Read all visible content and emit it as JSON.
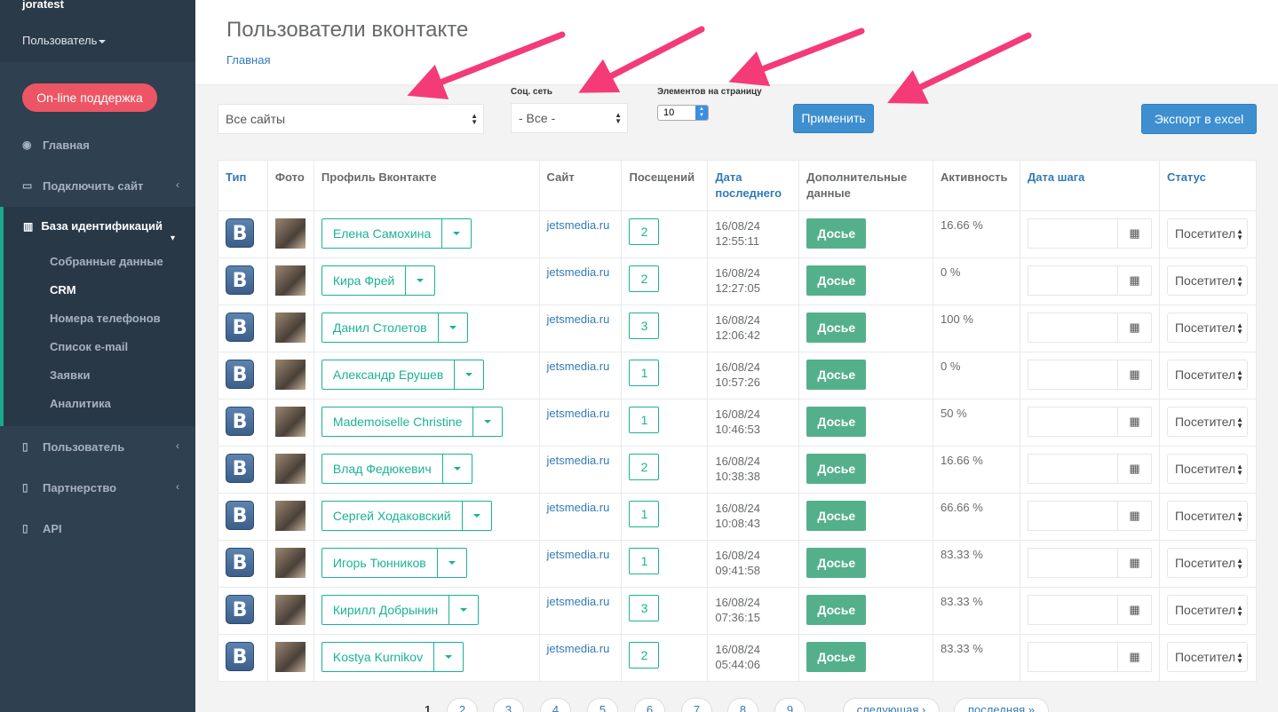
{
  "sidebar": {
    "username": "joratest",
    "role": "Пользователь",
    "support": "On-line поддержка",
    "items": [
      {
        "label": "Главная"
      },
      {
        "label": "Подключить сайт"
      },
      {
        "label": "База идентификаций"
      },
      {
        "label": "Пользователь"
      },
      {
        "label": "Партнерство"
      },
      {
        "label": "API"
      }
    ],
    "subitems": [
      "Собранные данные",
      "CRM",
      "Номера телефонов",
      "Список e-mail",
      "Заявки",
      "Аналитика"
    ]
  },
  "header": {
    "title": "Пользователи вконтакте",
    "breadcrumb": "Главная"
  },
  "filters": {
    "sites_value": "Все сайты",
    "social_label": "Соц. сеть",
    "social_value": "- Все -",
    "per_page_label": "Элементов на страницу",
    "per_page_value": "10",
    "apply": "Применить",
    "export": "Экспорт в excel"
  },
  "table": {
    "headers": [
      "Тип",
      "Фото",
      "Профиль Вконтакте",
      "Сайт",
      "Посещений",
      "Дата последнего",
      "Дополнительные данные",
      "Активность",
      "Дата шага",
      "Статус"
    ],
    "rows": [
      {
        "name": "Елена Самохина",
        "site": "jetsmedia.ru",
        "visits": "2",
        "date": "16/08/24",
        "time": "12:55:11",
        "activity": "16.66 %"
      },
      {
        "name": "Кира Фрей",
        "site": "jetsmedia.ru",
        "visits": "2",
        "date": "16/08/24",
        "time": "12:27:05",
        "activity": "0 %"
      },
      {
        "name": "Данил Столетов",
        "site": "jetsmedia.ru",
        "visits": "3",
        "date": "16/08/24",
        "time": "12:06:42",
        "activity": "100 %"
      },
      {
        "name": "Александр Ерушев",
        "site": "jetsmedia.ru",
        "visits": "1",
        "date": "16/08/24",
        "time": "10:57:26",
        "activity": "0 %"
      },
      {
        "name": "Mademoiselle Christine",
        "site": "jetsmedia.ru",
        "visits": "1",
        "date": "16/08/24",
        "time": "10:46:53",
        "activity": "50 %"
      },
      {
        "name": "Влад Федюкевич",
        "site": "jetsmedia.ru",
        "visits": "2",
        "date": "16/08/24",
        "time": "10:38:38",
        "activity": "16.66 %"
      },
      {
        "name": "Сергей Ходаковский",
        "site": "jetsmedia.ru",
        "visits": "1",
        "date": "16/08/24",
        "time": "10:08:43",
        "activity": "66.66 %"
      },
      {
        "name": "Игорь Тюнников",
        "site": "jetsmedia.ru",
        "visits": "1",
        "date": "16/08/24",
        "time": "09:41:58",
        "activity": "83.33 %"
      },
      {
        "name": "Кирилл Добрынин",
        "site": "jetsmedia.ru",
        "visits": "3",
        "date": "16/08/24",
        "time": "07:36:15",
        "activity": "83.33 %"
      },
      {
        "name": "Kostya Kurnikov",
        "site": "jetsmedia.ru",
        "visits": "2",
        "date": "16/08/24",
        "time": "05:44:06",
        "activity": "83.33 %"
      }
    ],
    "dossier_label": "Досье",
    "status_value": "Посетитель",
    "type_glyph": "B"
  },
  "pagination": {
    "current": "1",
    "pages": [
      "2",
      "3",
      "4",
      "5",
      "6",
      "7",
      "8",
      "9"
    ],
    "next": "следующая ›",
    "last": "последняя »"
  },
  "colors": {
    "sidebar": "#2f4050",
    "accent": "#1ab394",
    "primary": "#3e8fd0",
    "danger": "#ed5565",
    "annotation_arrow": "#f43b78"
  }
}
